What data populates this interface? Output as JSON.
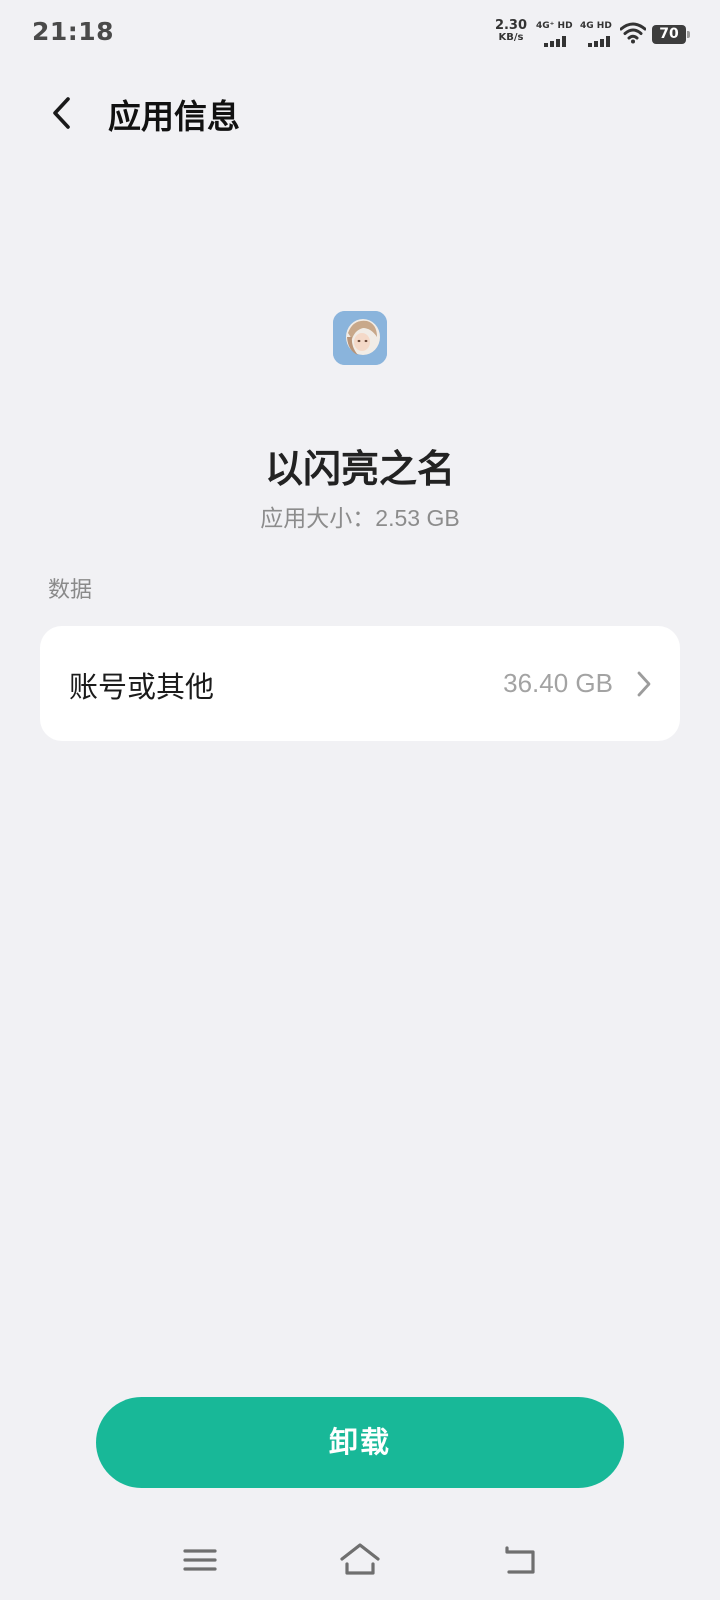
{
  "status_bar": {
    "time": "21:18",
    "net_speed_value": "2.30",
    "net_speed_unit": "KB/s",
    "sim1_label": "4G⁺ HD",
    "sim2_label": "4G HD",
    "battery_level": "70"
  },
  "header": {
    "title": "应用信息"
  },
  "app": {
    "name": "以闪亮之名",
    "size_label": "应用大小：",
    "size_value": "2.53 GB"
  },
  "data_section": {
    "label": "数据",
    "items": [
      {
        "label": "账号或其他",
        "value": "36.40 GB"
      }
    ]
  },
  "actions": {
    "uninstall_label": "卸载"
  },
  "colors": {
    "accent": "#18b898",
    "background": "#f1f1f4",
    "card": "#ffffff"
  },
  "icons": [
    "back-icon",
    "wifi-icon",
    "battery-icon",
    "chevron-right-icon",
    "menu-icon",
    "home-icon",
    "return-icon"
  ]
}
